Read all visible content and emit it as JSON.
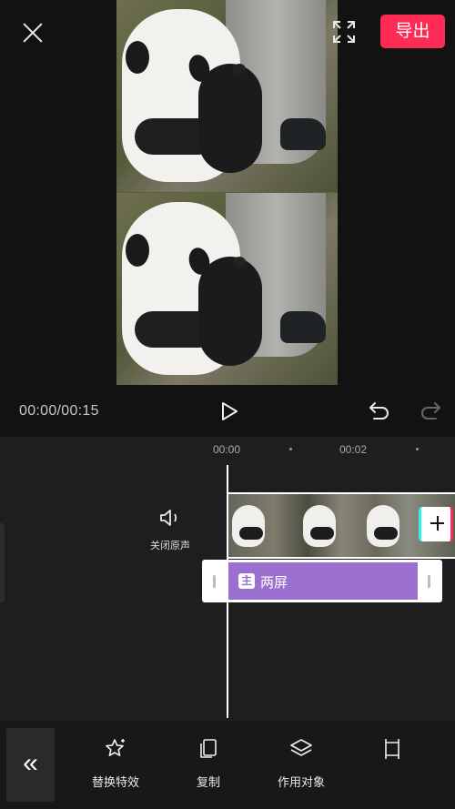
{
  "header": {
    "export_label": "导出"
  },
  "player": {
    "time": "00:00/00:15"
  },
  "timeline": {
    "ticks": [
      "00:00",
      "00:02"
    ],
    "audio_label": "关闭原声",
    "effect_badge": "主",
    "effect_label": "两屏"
  },
  "toolbar": {
    "collapse_label": "«",
    "items": [
      {
        "label": "替换特效",
        "icon": "star-sparkle-icon"
      },
      {
        "label": "复制",
        "icon": "copy-icon"
      },
      {
        "label": "作用对象",
        "icon": "layers-icon"
      },
      {
        "label": "",
        "icon": "crop-icon"
      }
    ]
  },
  "colors": {
    "accent": "#fe2c55",
    "effect": "#9b6fcf",
    "background": "#121212"
  }
}
